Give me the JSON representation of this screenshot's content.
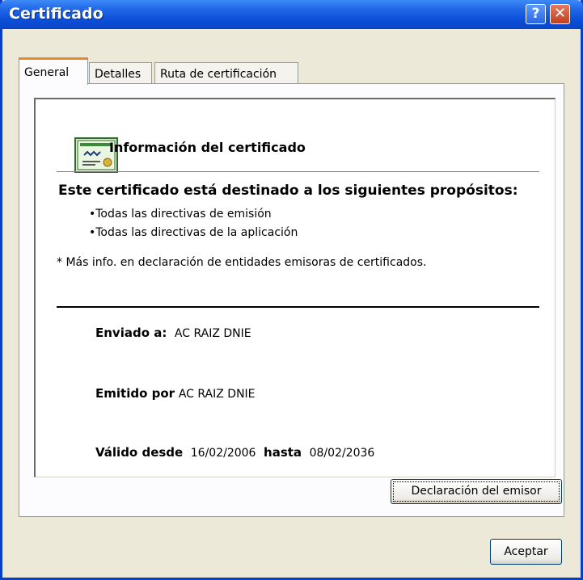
{
  "window": {
    "title": "Certificado"
  },
  "titlebar": {
    "help_glyph": "?",
    "close_glyph": "✕"
  },
  "tabs": [
    {
      "label": "General",
      "active": true
    },
    {
      "label": "Detalles",
      "active": false
    },
    {
      "label": "Ruta de certificación",
      "active": false
    }
  ],
  "general": {
    "icon": "certificate-icon",
    "info_title": "Información del certificado",
    "purpose_title": "Este certificado está destinado a los siguientes propósitos:",
    "purposes": [
      "•Todas las directivas de emisión",
      "•Todas las directivas de la aplicación"
    ],
    "note": "* Más info. en declaración de entidades emisoras de certificados.",
    "issued_to": {
      "label": "Enviado a:",
      "value": "AC RAIZ DNIE"
    },
    "issued_by": {
      "label": "Emitido por",
      "value": "AC RAIZ DNIE"
    },
    "validity": {
      "from_label": "Válido desde",
      "from": "16/02/2006",
      "to_label": "hasta",
      "to": "08/02/2036"
    },
    "issuer_statement_button": "Declaración del emisor"
  },
  "footer": {
    "ok_button": "Aceptar"
  },
  "colors": {
    "titlebar": "#0b4fd8",
    "dialog_bg": "#ece9d8",
    "active_tab_accent": "#e68b2c"
  }
}
